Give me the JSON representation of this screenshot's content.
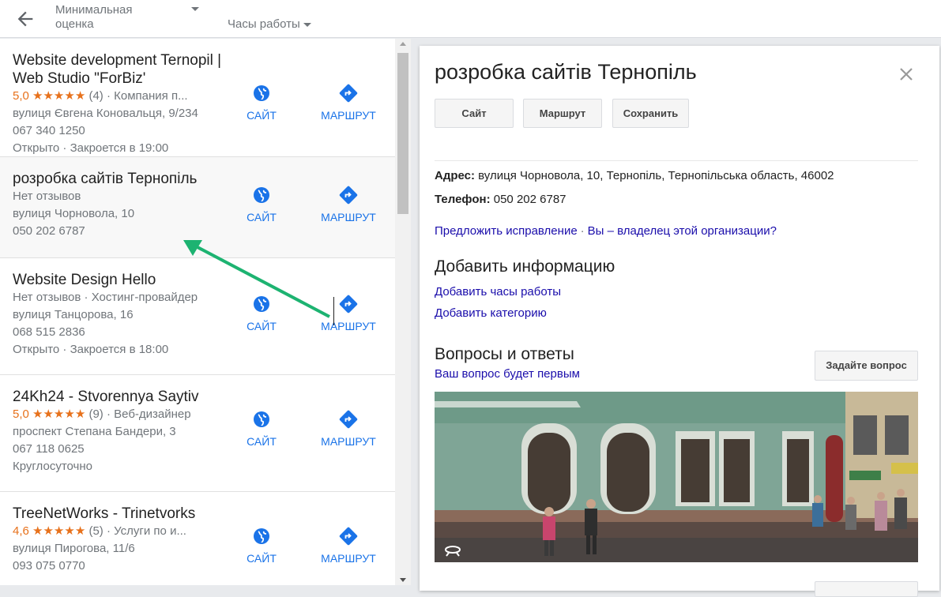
{
  "topbar": {
    "min_rating_label": "Минимальная оценка",
    "hours_label": "Часы работы"
  },
  "results": [
    {
      "title": "Website development Ternopil | Web Studio \"ForBiz'",
      "rating": "5,0",
      "stars": "★★★★★",
      "reviews": "(4)",
      "category": "Компания п...",
      "address": "вулиця Євгена Коновальця, 9/234",
      "phone": "067 340 1250",
      "hours": "Открыто · Закроется в 19:00",
      "site_label": "САЙТ",
      "route_label": "МАРШРУТ"
    },
    {
      "title": "розробка сайтів Тернопіль",
      "reviews_text": "Нет отзывов",
      "address": "вулиця Чорновола, 10",
      "phone": "050 202 6787",
      "site_label": "САЙТ",
      "route_label": "МАРШРУТ"
    },
    {
      "title": "Website Design Hello",
      "reviews_text": "Нет отзывов · Хостинг-провайдер",
      "address": "вулиця Танцорова, 16",
      "phone": "068 515 2836",
      "hours": "Открыто · Закроется в 18:00",
      "site_label": "САЙТ",
      "route_label": "МАРШРУТ"
    },
    {
      "title": "24Kh24 - Stvorennya Saytiv",
      "rating": "5,0",
      "stars": "★★★★★",
      "reviews": "(9)",
      "category": "Веб-дизайнер",
      "address": "проспект Степана Бандери, 3",
      "phone": "067 118 0625",
      "hours": "Круглосуточно",
      "site_label": "САЙТ",
      "route_label": "МАРШРУТ"
    },
    {
      "title": "TreeNetWorks - Trinetvorks",
      "rating": "4,6",
      "stars": "★★★★★",
      "reviews": "(5)",
      "category": "Услуги по и...",
      "address": "вулиця Пирогова, 11/6",
      "phone": "093 075 0770",
      "site_label": "САЙТ",
      "route_label": "МАРШРУТ"
    }
  ],
  "detail": {
    "title": "розробка сайтів Тернопіль",
    "btn_site": "Сайт",
    "btn_route": "Маршрут",
    "btn_save": "Сохранить",
    "address_label": "Адрес:",
    "address": "вулиця Чорновола, 10, Тернопіль, Тернопільська область, 46002",
    "phone_label": "Телефон:",
    "phone": "050 202 6787",
    "suggest_edit": "Предложить исправление",
    "owner_link": "Вы – владелец этой организации?",
    "add_info_heading": "Добавить информацию",
    "add_hours": "Добавить часы работы",
    "add_category": "Добавить категорию",
    "qa_heading": "Вопросы и ответы",
    "qa_first": "Ваш вопрос будет первым",
    "ask_button": "Задайте вопрос"
  },
  "colors": {
    "link": "#1a0dab",
    "action_blue": "#1a73e8",
    "star_orange": "#e7711b",
    "annotation_green": "#1db371"
  }
}
